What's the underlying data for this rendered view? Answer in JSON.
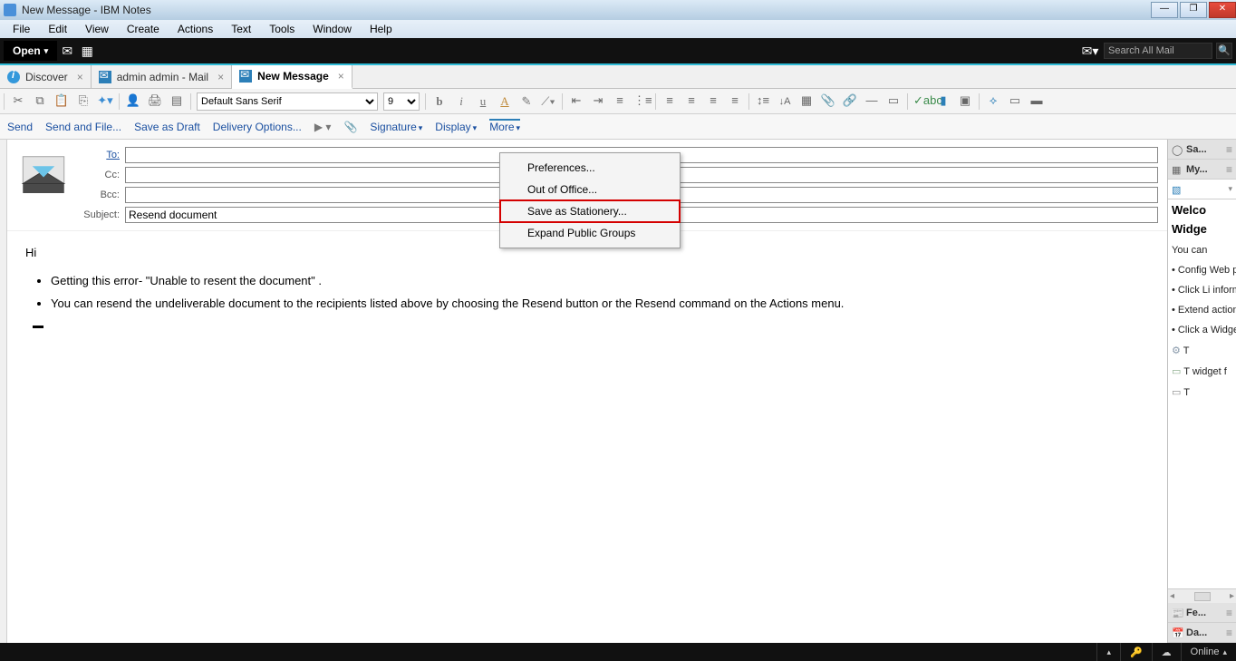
{
  "window": {
    "title": "New Message - IBM Notes"
  },
  "menubar": [
    "File",
    "Edit",
    "View",
    "Create",
    "Actions",
    "Text",
    "Tools",
    "Window",
    "Help"
  ],
  "blackbar": {
    "open": "Open",
    "search_placeholder": "Search All Mail"
  },
  "tabs": [
    {
      "label": "Discover",
      "icon": "info",
      "active": false
    },
    {
      "label": "admin admin - Mail",
      "icon": "mail",
      "active": false
    },
    {
      "label": "New Message",
      "icon": "mail",
      "active": true
    }
  ],
  "toolbar": {
    "font": "Default Sans Serif",
    "size": "9"
  },
  "actionbar": {
    "send": "Send",
    "send_file": "Send and File...",
    "save_draft": "Save as Draft",
    "delivery": "Delivery Options...",
    "signature": "Signature",
    "display": "Display",
    "more": "More"
  },
  "more_menu": [
    "Preferences...",
    "Out of Office...",
    "Save as Stationery...",
    "Expand Public Groups"
  ],
  "fields": {
    "to_label": "To:",
    "cc_label": "Cc:",
    "bcc_label": "Bcc:",
    "subject_label": "Subject:",
    "to": "",
    "cc": "",
    "bcc": "",
    "subject": "Resend document"
  },
  "body": {
    "greeting": "Hi",
    "line1": "Getting this error- \"Unable to resent the document\" .",
    "line2": "You can resend the undeliverable document to the recipients listed above by choosing the Resend button or the Resend command on the Actions menu."
  },
  "sidepanel": {
    "h1": "Sa...",
    "h2": "My...",
    "h3": "Fe...",
    "h4": "Da...",
    "title": "Welco",
    "sub": "Widge",
    "p0": "You can",
    "p1": "• Config Web pag",
    "p2": "• Click Li informat look up",
    "p3": "• Extend actions y",
    "p4": "• Click a Widgets",
    "t1": "T",
    "t2": "T widget f",
    "t3": "T"
  },
  "status": {
    "online": "Online"
  }
}
